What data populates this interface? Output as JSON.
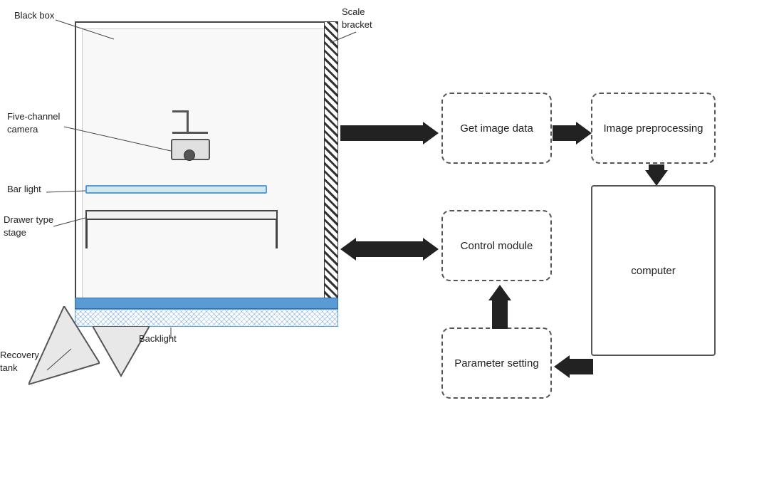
{
  "labels": {
    "black_box": "Black box",
    "scale_bracket": "Scale\nbracket",
    "five_channel_camera": "Five-channel\ncamera",
    "bar_light": "Bar light",
    "drawer_type_stage": "Drawer type\nstage",
    "recovery_tank": "Recovery\ntank",
    "backlight": "Backlight",
    "get_image_data": "Get image\ndata",
    "image_preprocessing": "Image\npreprocessing",
    "control_module": "Control\nmodule",
    "computer": "computer",
    "parameter_setting": "Parameter\nsetting"
  },
  "colors": {
    "border": "#444",
    "dashed": "#555",
    "blue": "#5b9bd5",
    "arrow": "#222",
    "bg": "#fff"
  }
}
